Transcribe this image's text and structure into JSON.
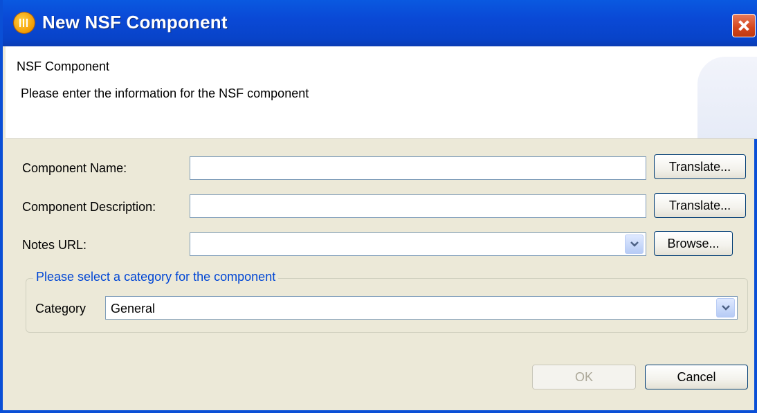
{
  "window": {
    "title": "New NSF Component",
    "icon": "notes-app-icon",
    "close_icon": "close-icon"
  },
  "banner": {
    "title": "NSF Component",
    "message": "Please enter the information for the NSF component"
  },
  "form": {
    "component_name": {
      "label": "Component Name:",
      "value": "",
      "button": "Translate..."
    },
    "component_description": {
      "label": "Component Description:",
      "value": "",
      "button": "Translate..."
    },
    "notes_url": {
      "label": "Notes URL:",
      "value": "",
      "button": "Browse..."
    }
  },
  "category_group": {
    "title": "Please select a category for the component",
    "label": "Category",
    "selected": "General"
  },
  "buttons": {
    "ok": "OK",
    "cancel": "Cancel"
  },
  "colors": {
    "title_bar": "#0a4fd6",
    "dialog_bg": "#ece9d8",
    "group_title": "#0046d5",
    "close_button": "#d4461c"
  }
}
